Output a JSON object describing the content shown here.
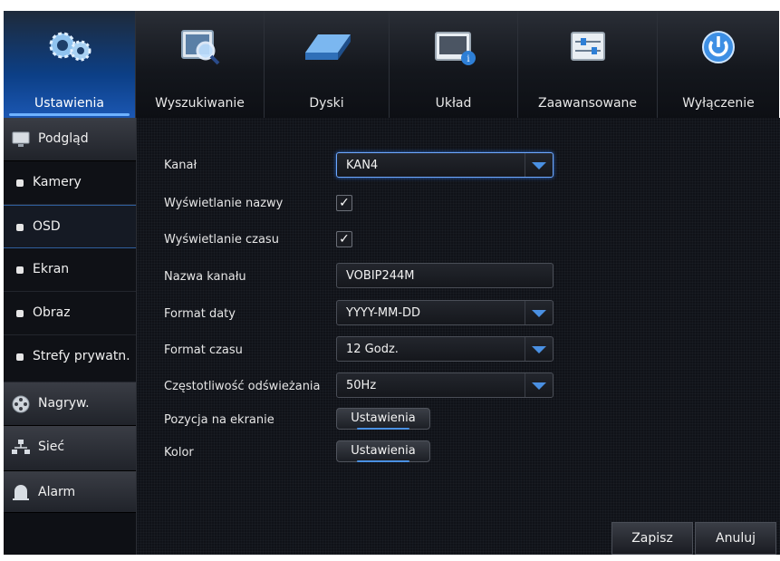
{
  "topnav": {
    "tabs": [
      {
        "label": "Ustawienia",
        "icon": "gears-icon",
        "active": true
      },
      {
        "label": "Wyszukiwanie",
        "icon": "magnifier-icon",
        "active": false
      },
      {
        "label": "Dyski",
        "icon": "hard-disk-icon",
        "active": false
      },
      {
        "label": "Układ",
        "icon": "system-info-icon",
        "active": false
      },
      {
        "label": "Zaawansowane",
        "icon": "sliders-icon",
        "active": false
      },
      {
        "label": "Wyłączenie",
        "icon": "power-icon",
        "active": false
      }
    ]
  },
  "sidebar": {
    "items": [
      {
        "label": "Podgląd",
        "type": "group",
        "icon": "monitor-icon"
      },
      {
        "label": "Kamery",
        "type": "sub"
      },
      {
        "label": "OSD",
        "type": "sub",
        "selected": true
      },
      {
        "label": "Ekran",
        "type": "sub"
      },
      {
        "label": "Obraz",
        "type": "sub"
      },
      {
        "label": "Strefy prywatn.",
        "type": "sub"
      },
      {
        "label": "Nagryw.",
        "type": "group",
        "icon": "film-reel-icon"
      },
      {
        "label": "Sieć",
        "type": "group",
        "icon": "network-icon"
      },
      {
        "label": "Alarm",
        "type": "group",
        "icon": "alarm-bell-icon"
      }
    ]
  },
  "form": {
    "channel": {
      "label": "Kanał",
      "value": "KAN4"
    },
    "show_name": {
      "label": "Wyświetlanie nazwy",
      "checked": true
    },
    "show_time": {
      "label": "Wyświetlanie czasu",
      "checked": true
    },
    "channel_name": {
      "label": "Nazwa kanału",
      "value": "VOBIP244M"
    },
    "date_format": {
      "label": "Format daty",
      "value": "YYYY-MM-DD"
    },
    "time_format": {
      "label": "Format czasu",
      "value": "12 Godz."
    },
    "refresh_rate": {
      "label": "Częstotliwość odświeżania",
      "value": "50Hz"
    },
    "position": {
      "label": "Pozycja na ekranie",
      "button": "Ustawienia"
    },
    "color": {
      "label": "Kolor",
      "button": "Ustawienia"
    }
  },
  "footer": {
    "save_label": "Zapisz",
    "cancel_label": "Anuluj"
  },
  "colors": {
    "accent": "#4a90e2",
    "active_tab": "#1b57b3",
    "background": "#101218"
  }
}
